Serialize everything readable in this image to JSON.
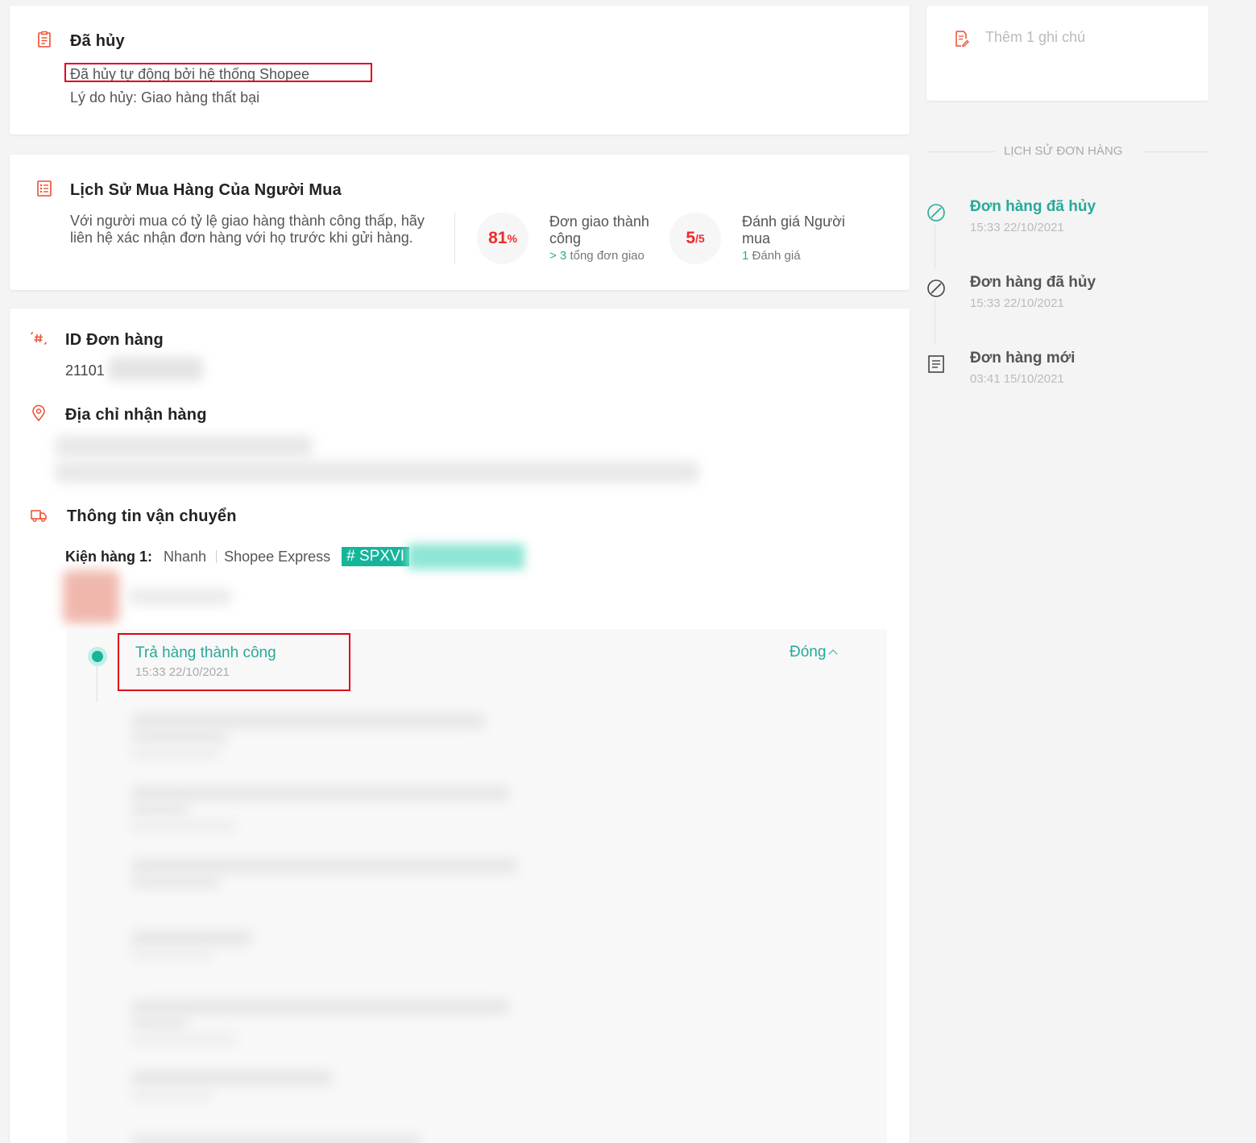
{
  "status": {
    "title": "Đã hủy",
    "auto_cancel": "Đã hủy tự động bởi hệ thống Shopee",
    "reason": "Lý do hủy: Giao hàng thất bại"
  },
  "buyer_history": {
    "title": "Lịch Sử Mua Hàng Của Người Mua",
    "description": "Với người mua có tỷ lệ giao hàng thành công thấp, hãy liên hệ xác nhận đơn hàng với họ trước khi gửi hàng.",
    "success_rate": {
      "value": "81",
      "unit": "%",
      "label": "Đơn giao thành công",
      "sub_value": "> 3",
      "sub_text": "tổng đơn giao"
    },
    "rating": {
      "value": "5",
      "unit": "/5",
      "label": "Đánh giá Người mua",
      "sub_value": "1",
      "sub_text": "Đánh giá"
    }
  },
  "order": {
    "id_title": "ID Đơn hàng",
    "id_value": "21101",
    "address_title": "Địa chỉ nhận hàng",
    "shipping_title": "Thông tin vận chuyển",
    "package_label": "Kiện hàng 1:",
    "package_speed": "Nhanh",
    "carrier": "Shopee Express",
    "tracking_prefix": "# SPXVI",
    "tracking": {
      "latest_status": "Trả hàng thành công",
      "latest_time": "15:33 22/10/2021",
      "close_label": "Đóng"
    }
  },
  "note": {
    "placeholder": "Thêm 1 ghi chú"
  },
  "order_history": {
    "heading": "LỊCH SỬ ĐƠN HÀNG",
    "events": [
      {
        "title": "Đơn hàng đã hủy",
        "time": "15:33 22/10/2021"
      },
      {
        "title": "Đơn hàng đã hủy",
        "time": "15:33 22/10/2021"
      },
      {
        "title": "Đơn hàng mới",
        "time": "03:41 15/10/2021"
      }
    ]
  },
  "colors": {
    "accent_orange": "#ee4d2d",
    "accent_teal": "#26aa99",
    "highlight_red": "#e0001a"
  }
}
